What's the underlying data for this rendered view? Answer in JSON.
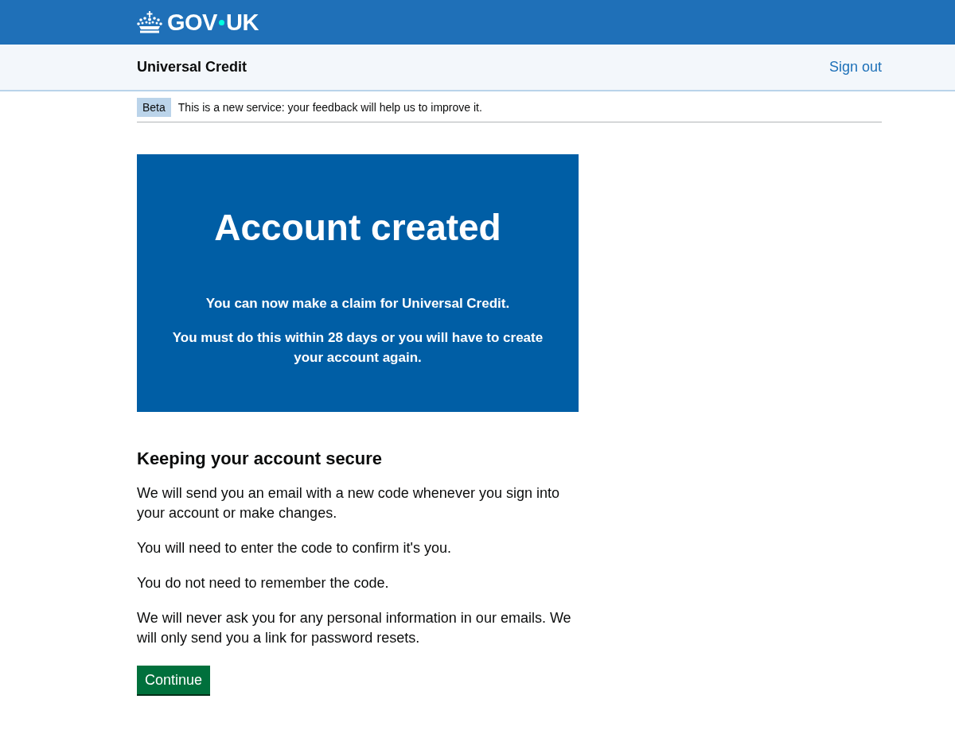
{
  "header": {
    "logo": {
      "left": "GOV",
      "right": "UK"
    }
  },
  "service_bar": {
    "title": "Universal Credit",
    "sign_out": "Sign out"
  },
  "phase_banner": {
    "tag": "Beta",
    "text": "This is a new service: your feedback will help us to improve it."
  },
  "panel": {
    "title": "Account created",
    "paragraphs": [
      "You can now make a claim for Universal Credit.",
      "You must do this within 28 days or you will have to create your account again."
    ]
  },
  "section": {
    "heading": "Keeping your account secure",
    "paragraphs": [
      "We will send you an email with a new code whenever you sign into your account or make changes.",
      "You will need to enter the code to confirm it's you.",
      "You do not need to remember the code.",
      "We will never ask you for any personal information in our emails. We will only send you a link for password resets."
    ]
  },
  "button": {
    "label": "Continue"
  }
}
